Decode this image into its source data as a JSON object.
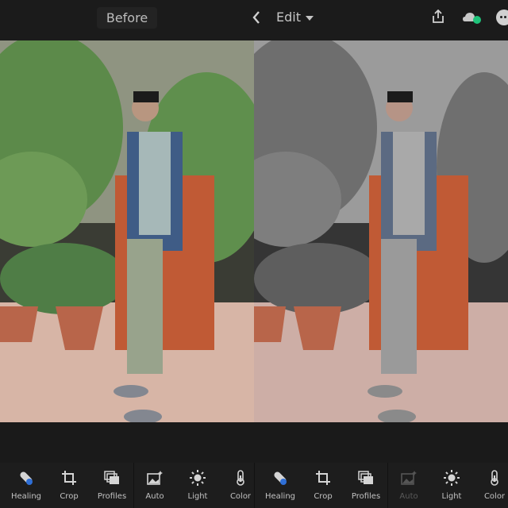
{
  "topbar": {
    "before_label": "Before",
    "edit_label": "Edit",
    "icons": [
      "back-chevron-icon",
      "dropdown-caret-icon",
      "share-icon",
      "cloud-sync-icon",
      "more-icon"
    ],
    "sync_status_color": "#1fc47a"
  },
  "photos": [
    {
      "side": "left",
      "mode": "color"
    },
    {
      "side": "right",
      "mode": "selective-color-edit"
    }
  ],
  "toolbars": [
    {
      "tools": [
        {
          "label": "Healing",
          "icon": "healing-bandage-icon",
          "enabled": true
        },
        {
          "label": "Crop",
          "icon": "crop-icon",
          "enabled": true
        },
        {
          "label": "Profiles",
          "icon": "profiles-icon",
          "enabled": true
        },
        {
          "label": "Auto",
          "icon": "auto-image-icon",
          "enabled": true
        },
        {
          "label": "Light",
          "icon": "sun-icon",
          "enabled": true
        },
        {
          "label": "Color",
          "icon": "thermometer-icon",
          "enabled": true
        }
      ]
    },
    {
      "tools": [
        {
          "label": "Healing",
          "icon": "healing-bandage-icon",
          "enabled": true
        },
        {
          "label": "Crop",
          "icon": "crop-icon",
          "enabled": true
        },
        {
          "label": "Profiles",
          "icon": "profiles-icon",
          "enabled": true
        },
        {
          "label": "Auto",
          "icon": "auto-image-icon",
          "enabled": false
        },
        {
          "label": "Light",
          "icon": "sun-icon",
          "enabled": true
        },
        {
          "label": "Color",
          "icon": "thermometer-icon",
          "enabled": true
        }
      ]
    }
  ]
}
